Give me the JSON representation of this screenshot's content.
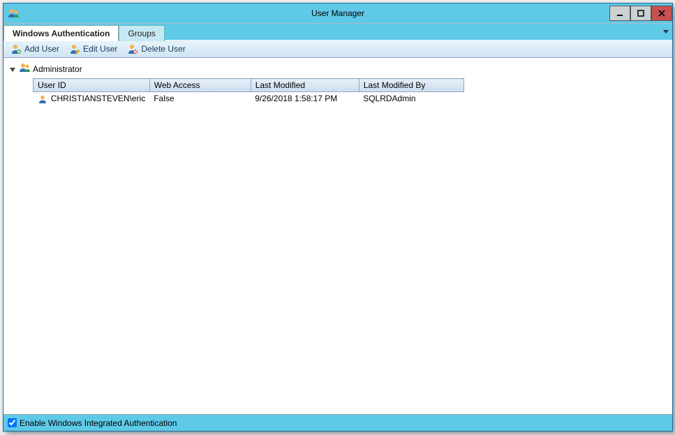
{
  "window": {
    "title": "User Manager"
  },
  "tabs": {
    "auth": "Windows Authentication",
    "groups": "Groups"
  },
  "toolbar": {
    "add": "Add User",
    "edit": "Edit User",
    "delete": "Delete User"
  },
  "tree": {
    "root": "Administrator"
  },
  "columns": {
    "userid": "User ID",
    "webaccess": "Web Access",
    "lastmod": "Last Modified",
    "lastmodby": "Last Modified By"
  },
  "rows": [
    {
      "userid": "CHRISTIANSTEVEN\\eric",
      "webaccess": "False",
      "lastmod": "9/26/2018 1:58:17 PM",
      "lastmodby": "SQLRDAdmin"
    }
  ],
  "status": {
    "checkbox_label": "Enable Windows Integrated Authentication",
    "checked": true
  }
}
